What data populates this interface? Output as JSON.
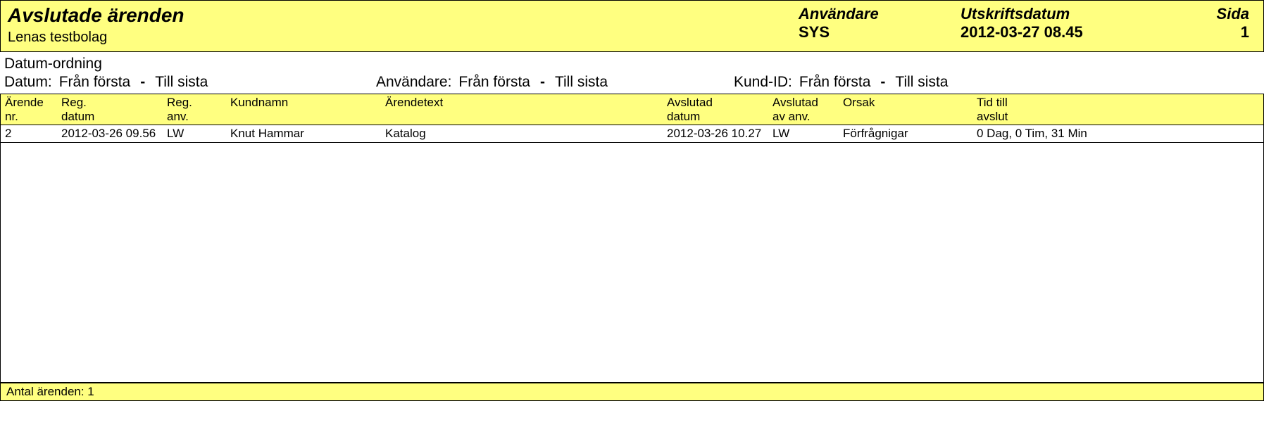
{
  "header": {
    "title": "Avslutade ärenden",
    "subtitle": "Lenas testbolag",
    "user_label": "Användare",
    "user_value": "SYS",
    "printdate_label": "Utskriftsdatum",
    "printdate_value": "2012-03-27 08.45",
    "page_label": "Sida",
    "page_value": "1"
  },
  "filters": {
    "sort": "Datum-ordning",
    "datum_label": "Datum:",
    "datum_from": "Från första",
    "datum_sep": "-",
    "datum_to": "Till sista",
    "anv_label": "Användare:",
    "anv_from": "Från första",
    "anv_sep": "-",
    "anv_to": "Till sista",
    "kund_label": "Kund-ID:",
    "kund_from": "Från första",
    "kund_sep": "-",
    "kund_to": "Till sista"
  },
  "columns": {
    "nr1": "Ärende",
    "nr2": "nr.",
    "regd1": "Reg.",
    "regd2": "datum",
    "reganv1": "Reg.",
    "reganv2": "anv.",
    "kund1": "",
    "kund2": "Kundnamn",
    "text1": "",
    "text2": "Ärendetext",
    "avsd1": "Avslutad",
    "avsd2": "datum",
    "avsanv1": "Avslutad",
    "avsanv2": "av anv.",
    "orsak1": "",
    "orsak2": "Orsak",
    "tid1": "Tid till",
    "tid2": "avslut"
  },
  "rows": [
    {
      "nr": "2",
      "regd": "2012-03-26 09.56",
      "reganv": "LW",
      "kund": "Knut Hammar",
      "text": "Katalog",
      "avsd": "2012-03-26 10.27",
      "avsanv": "LW",
      "orsak": "Förfrågnigar",
      "tid": " 0 Dag, 0 Tim, 31 Min"
    }
  ],
  "footer": {
    "count_text": "Antal ärenden: 1"
  }
}
